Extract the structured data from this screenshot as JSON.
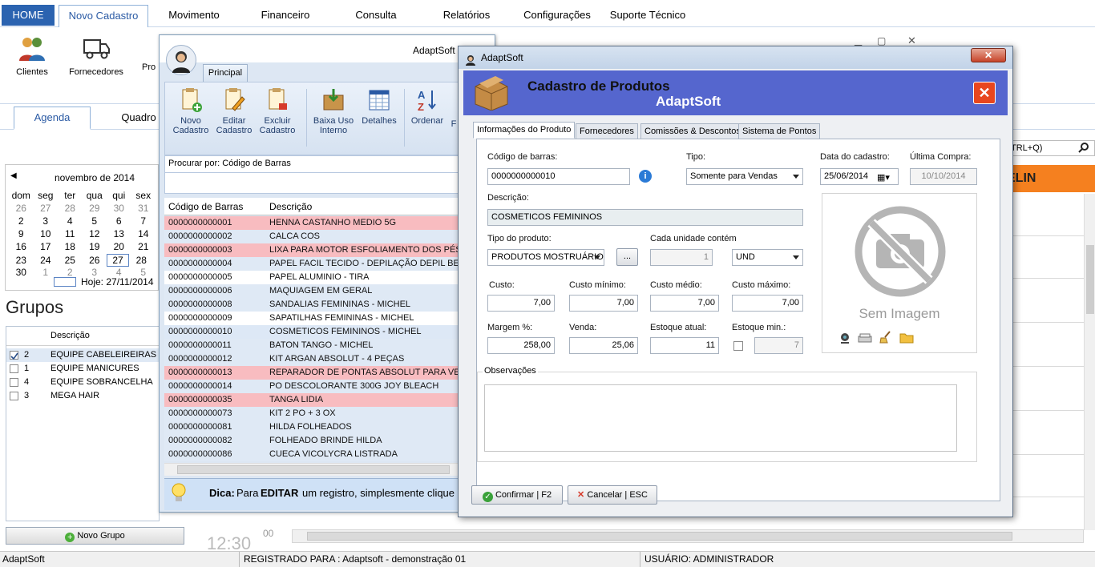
{
  "menu": {
    "home": "HOME",
    "novo_cadastro": "Novo Cadastro",
    "movimento": "Movimento",
    "financeiro": "Financeiro",
    "consulta": "Consulta",
    "relatorios": "Relatórios",
    "configuracoes": "Configurações",
    "suporte": "Suporte Técnico"
  },
  "ribbon": {
    "clientes": "Clientes",
    "fornecedores": "Fornecedores",
    "produtos_partial": "Pro"
  },
  "agenda_tabs": {
    "agenda": "Agenda",
    "quadro": "Quadro"
  },
  "calendar": {
    "month": "novembro de 2014",
    "weekdays": [
      "dom",
      "seg",
      "ter",
      "qua",
      "qui",
      "sex"
    ],
    "weeks": [
      [
        "26",
        "27",
        "28",
        "29",
        "30",
        "31"
      ],
      [
        "2",
        "3",
        "4",
        "5",
        "6",
        "7"
      ],
      [
        "9",
        "10",
        "11",
        "12",
        "13",
        "14"
      ],
      [
        "16",
        "17",
        "18",
        "19",
        "20",
        "21"
      ],
      [
        "23",
        "24",
        "25",
        "26",
        "27",
        "28"
      ],
      [
        "30",
        "1",
        "2",
        "3",
        "4",
        "5"
      ]
    ],
    "today": "Hoje: 27/11/2014"
  },
  "grupos": {
    "title": "Grupos",
    "col_descricao": "Descrição",
    "rows": [
      {
        "num": "2",
        "desc": "EQUIPE CABELEIREIRAS",
        "checked": true
      },
      {
        "num": "1",
        "desc": "EQUIPE MANICURES",
        "checked": false
      },
      {
        "num": "4",
        "desc": "EQUIPE SOBRANCELHA",
        "checked": false
      },
      {
        "num": "3",
        "desc": "MEGA HAIR",
        "checked": false
      }
    ],
    "novo_grupo": "Novo Grupo"
  },
  "right_panel": {
    "shortcut": "TRL+Q)",
    "orange_text": "ELIN",
    "time": "12:30",
    "mins": "00"
  },
  "status": {
    "app": "AdaptSoft",
    "registrado": "REGISTRADO PARA : Adaptsoft - demonstração 01",
    "usuario": "USUÁRIO: ADMINISTRADOR"
  },
  "midwin": {
    "title": "AdaptSoft",
    "ribbon_tab": "Principal",
    "buttons": [
      {
        "l1": "Novo",
        "l2": "Cadastro"
      },
      {
        "l1": "Editar",
        "l2": "Cadastro"
      },
      {
        "l1": "Excluir",
        "l2": "Cadastro"
      },
      {
        "l1": "Baixa Uso",
        "l2": "Interno"
      },
      {
        "l1": "Detalhes",
        "l2": ""
      },
      {
        "l1": "Ordenar",
        "l2": ""
      },
      {
        "l1": "F",
        "l2": ""
      }
    ],
    "procurar": "Procurar por: Código de Barras",
    "col_codigo": "Código de Barras",
    "col_descricao": "Descrição",
    "rows": [
      {
        "code": "0000000000001",
        "desc": "HENNA CASTANHO MEDIO 5G",
        "style": "pink"
      },
      {
        "code": "0000000000002",
        "desc": "CALCA COS",
        "style": "lblue"
      },
      {
        "code": "0000000000003",
        "desc": "LIXA PARA MOTOR ESFOLIAMENTO DOS PÉS",
        "style": "pink"
      },
      {
        "code": "0000000000004",
        "desc": "PAPEL FACIL TECIDO - DEPILAÇÃO DEPIL BELLA",
        "style": "lblue"
      },
      {
        "code": "0000000000005",
        "desc": "PAPEL ALUMINIO - TIRA",
        "style": "white"
      },
      {
        "code": "0000000000006",
        "desc": "MAQUIAGEM EM GERAL",
        "style": "lblue"
      },
      {
        "code": "0000000000008",
        "desc": "SANDALIAS FEMININAS - MICHEL",
        "style": "lblue"
      },
      {
        "code": "0000000000009",
        "desc": "SAPATILHAS FEMININAS - MICHEL",
        "style": "white"
      },
      {
        "code": "0000000000010",
        "desc": "COSMETICOS FEMININOS - MICHEL",
        "style": "sel"
      },
      {
        "code": "0000000000011",
        "desc": "BATON TANGO - MICHEL",
        "style": "lblue"
      },
      {
        "code": "0000000000012",
        "desc": "KIT ARGAN ABSOLUT - 4 PEÇAS",
        "style": "lblue"
      },
      {
        "code": "0000000000013",
        "desc": "REPARADOR DE PONTAS ABSOLUT PARA VEN...",
        "style": "pink"
      },
      {
        "code": "0000000000014",
        "desc": "PO DESCOLORANTE 300G JOY BLEACH",
        "style": "lblue"
      },
      {
        "code": "0000000000035",
        "desc": "TANGA LIDIA",
        "style": "pink"
      },
      {
        "code": "0000000000073",
        "desc": "KIT 2 PO + 3 OX",
        "style": "lblue"
      },
      {
        "code": "0000000000081",
        "desc": "HILDA FOLHEADOS",
        "style": "lblue"
      },
      {
        "code": "0000000000082",
        "desc": "FOLHEADO BRINDE HILDA",
        "style": "lblue"
      },
      {
        "code": "0000000000086",
        "desc": "CUECA VICOLYCRA LISTRADA",
        "style": "lblue"
      }
    ],
    "dica_label": "Dica:",
    "dica_text": "Para",
    "dica_bold": "EDITAR",
    "dica_rest": "um registro, simplesmente clique"
  },
  "dialog": {
    "title": "AdaptSoft",
    "header_title": "Cadastro de Produtos",
    "header_sub": "AdaptSoft",
    "tabs": [
      "Informações do Produto",
      "Fornecedores",
      "Comissões & Descontos",
      "Sistema de Pontos"
    ],
    "codigo_label": "Código de barras:",
    "codigo": "0000000000010",
    "tipo_label": "Tipo:",
    "tipo": "Somente para Vendas",
    "data_label": "Data do cadastro:",
    "data": "25/06/2014",
    "ultima_label": "Última Compra:",
    "ultima": "10/10/2014",
    "descricao_label": "Descrição:",
    "descricao": "COSMETICOS FEMININOS",
    "tipo_prod_label": "Tipo do produto:",
    "tipo_prod": "PRODUTOS MOSTRUÁRIO",
    "cada_label": "Cada unidade contém",
    "cada": "1",
    "unidade": "UND",
    "custo_label": "Custo:",
    "custo": "7,00",
    "custo_min_label": "Custo mínimo:",
    "custo_min": "7,00",
    "custo_med_label": "Custo médio:",
    "custo_med": "7,00",
    "custo_max_label": "Custo máximo:",
    "custo_max": "7,00",
    "margem_label": "Margem %:",
    "margem": "258,00",
    "venda_label": "Venda:",
    "venda": "25,06",
    "estoque_label": "Estoque atual:",
    "estoque": "11",
    "estoque_min_label": "Estoque min.:",
    "estoque_min": "7",
    "sem_imagem": "Sem Imagem",
    "obs_label": "Observações",
    "confirmar": "Confirmar | F2",
    "cancelar": "Cancelar | ESC",
    "ellipsis": "..."
  }
}
